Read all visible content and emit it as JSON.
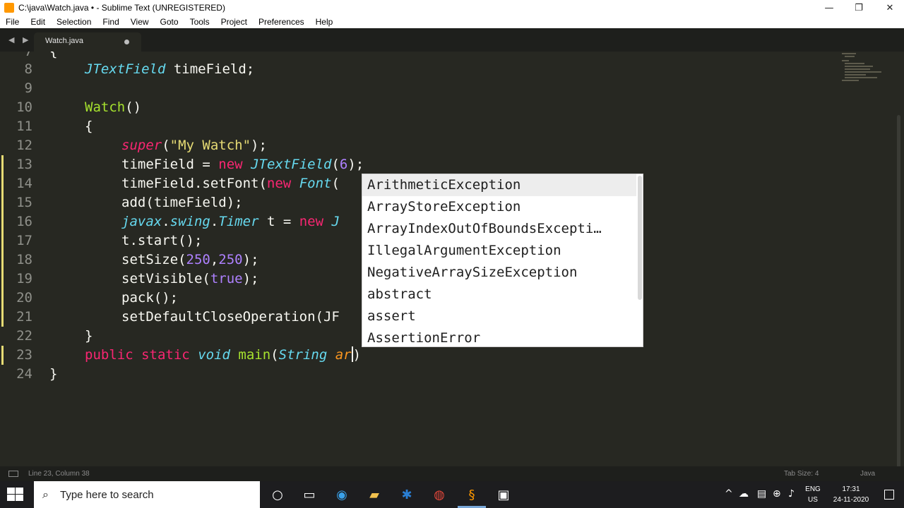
{
  "window": {
    "title": "C:\\java\\Watch.java • - Sublime Text (UNREGISTERED)",
    "controls": {
      "minimize": "—",
      "restore": "❐",
      "close": "✕"
    }
  },
  "menu": [
    "File",
    "Edit",
    "Selection",
    "Find",
    "View",
    "Goto",
    "Tools",
    "Project",
    "Preferences",
    "Help"
  ],
  "tabs": [
    {
      "label": "Watch.java",
      "dirty": true
    }
  ],
  "nav_arrows": "◀ ▶",
  "editor": {
    "partial_top_line": {
      "number": "7",
      "text": "{"
    },
    "line_numbers": [
      "8",
      "9",
      "10",
      "11",
      "12",
      "13",
      "14",
      "15",
      "16",
      "17",
      "18",
      "19",
      "20",
      "21",
      "22",
      "23",
      "24"
    ],
    "lines": {
      "l8": {
        "cls": "JTextField",
        "rest": " timeField;"
      },
      "l10": {
        "fn": "Watch",
        "rest": "()"
      },
      "l11": {
        "text": "{"
      },
      "l12": {
        "kw": "super",
        "a": "(",
        "str": "\"My Watch\"",
        "b": ");"
      },
      "l13": {
        "a": "timeField = ",
        "kw": "new",
        "sp": " ",
        "cls": "JTextField",
        "b": "(",
        "num": "6",
        "c": ");"
      },
      "l14": {
        "a": "timeField.setFont(",
        "kw": "new",
        "sp": " ",
        "cls": "Font",
        "b": "("
      },
      "l15": {
        "text": "add(timeField);"
      },
      "l16": {
        "cls1": "javax",
        "d1": ".",
        "cls2": "swing",
        "d2": ".",
        "cls3": "Timer",
        "a": " t = ",
        "kw": "new",
        "b": " J"
      },
      "l17": {
        "text": "t.start();"
      },
      "l18": {
        "a": "setSize(",
        "n1": "250",
        "c": ",",
        "n2": "250",
        "b": ");"
      },
      "l19": {
        "a": "setVisible(",
        "kw": "true",
        "b": ");"
      },
      "l20": {
        "text": "pack();"
      },
      "l21": {
        "text": "setDefaultCloseOperation(JF"
      },
      "l22": {
        "text": "}"
      },
      "l23": {
        "kw1": "public",
        "kw2": "static",
        "cls1": "void",
        "fn": "main",
        "a": "(",
        "cls2": "String",
        "param": "ar",
        "b": ")"
      },
      "l24": {
        "text": "}"
      }
    }
  },
  "autocomplete": {
    "selected_index": 0,
    "items": [
      "ArithmeticException",
      "ArrayStoreException",
      "ArrayIndexOutOfBoundsExcepti…",
      "IllegalArgumentException",
      "NegativeArraySizeException",
      "abstract",
      "assert",
      "AssertionError"
    ]
  },
  "status": {
    "position": "Line 23, Column 38",
    "tab_size": "Tab Size: 4",
    "syntax": "Java"
  },
  "taskbar": {
    "search_placeholder": "Type here to search",
    "language": [
      "ENG",
      "US"
    ],
    "time": "17:31",
    "date": "24-11-2020"
  },
  "colors": {
    "background": "#272822",
    "keyword": "#f92672",
    "class": "#66d9ef",
    "function": "#a6e22e",
    "string": "#e6db74",
    "number": "#ae81ff"
  }
}
